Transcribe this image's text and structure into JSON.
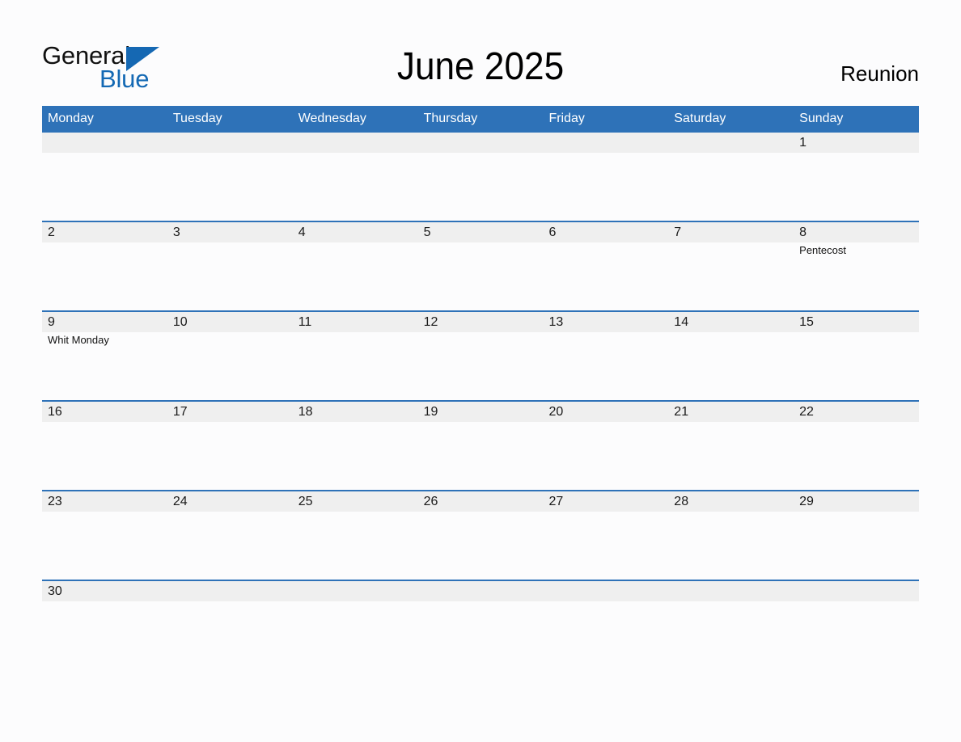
{
  "brand": {
    "name_part1": "General",
    "name_part2": "Blue",
    "triangle_icon": "triangle-icon",
    "primary_color": "#1568b3"
  },
  "header": {
    "title": "June 2025",
    "month": "June",
    "year": "2025",
    "region": "Reunion"
  },
  "theme": {
    "header_blue": "#2e72b8",
    "row_divider": "#2e72b8",
    "daynum_band": "#efefef",
    "page_background": "#fcfcfd",
    "text": "#1a1a1a"
  },
  "weekdays": [
    "Monday",
    "Tuesday",
    "Wednesday",
    "Thursday",
    "Friday",
    "Saturday",
    "Sunday"
  ],
  "weeks": [
    {
      "days": [
        {
          "number": "",
          "event": ""
        },
        {
          "number": "",
          "event": ""
        },
        {
          "number": "",
          "event": ""
        },
        {
          "number": "",
          "event": ""
        },
        {
          "number": "",
          "event": ""
        },
        {
          "number": "",
          "event": ""
        },
        {
          "number": "1",
          "event": ""
        }
      ]
    },
    {
      "days": [
        {
          "number": "2",
          "event": ""
        },
        {
          "number": "3",
          "event": ""
        },
        {
          "number": "4",
          "event": ""
        },
        {
          "number": "5",
          "event": ""
        },
        {
          "number": "6",
          "event": ""
        },
        {
          "number": "7",
          "event": ""
        },
        {
          "number": "8",
          "event": "Pentecost"
        }
      ]
    },
    {
      "days": [
        {
          "number": "9",
          "event": "Whit Monday"
        },
        {
          "number": "10",
          "event": ""
        },
        {
          "number": "11",
          "event": ""
        },
        {
          "number": "12",
          "event": ""
        },
        {
          "number": "13",
          "event": ""
        },
        {
          "number": "14",
          "event": ""
        },
        {
          "number": "15",
          "event": ""
        }
      ]
    },
    {
      "days": [
        {
          "number": "16",
          "event": ""
        },
        {
          "number": "17",
          "event": ""
        },
        {
          "number": "18",
          "event": ""
        },
        {
          "number": "19",
          "event": ""
        },
        {
          "number": "20",
          "event": ""
        },
        {
          "number": "21",
          "event": ""
        },
        {
          "number": "22",
          "event": ""
        }
      ]
    },
    {
      "days": [
        {
          "number": "23",
          "event": ""
        },
        {
          "number": "24",
          "event": ""
        },
        {
          "number": "25",
          "event": ""
        },
        {
          "number": "26",
          "event": ""
        },
        {
          "number": "27",
          "event": ""
        },
        {
          "number": "28",
          "event": ""
        },
        {
          "number": "29",
          "event": ""
        }
      ]
    },
    {
      "days": [
        {
          "number": "30",
          "event": ""
        },
        {
          "number": "",
          "event": ""
        },
        {
          "number": "",
          "event": ""
        },
        {
          "number": "",
          "event": ""
        },
        {
          "number": "",
          "event": ""
        },
        {
          "number": "",
          "event": ""
        },
        {
          "number": "",
          "event": ""
        }
      ]
    }
  ]
}
